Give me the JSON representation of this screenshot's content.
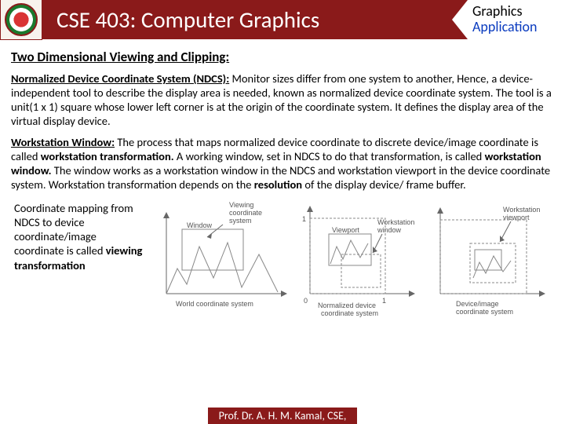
{
  "header": {
    "title": "CSE 403: Computer Graphics",
    "corner_line1": "Graphics",
    "corner_line2": "Application"
  },
  "section_title": "Two Dimensional Viewing and Clipping:",
  "p1": {
    "lead": "Normalized Device Coordinate System (NDCS):",
    "body": " Monitor sizes differ from one system to another, Hence, a device-independent tool to describe the display area is needed, known as normalized device coordinate system. The tool is a unit(1 x 1) square whose lower left corner is at the origin of the coordinate system. It defines the display area of the virtual display device."
  },
  "p2": {
    "lead": "Workstation Window:",
    "t1": " The process that maps normalized device coordinate to discrete device/image coordinate is called ",
    "b1": "workstation transformation.",
    "t2": " A working window, set in NDCS to do that transformation, is called ",
    "b2": "workstation window.",
    "t3": " The window works as a workstation window in the NDCS and workstation viewport in the device coordinate system. Workstation transformation depends on the ",
    "b3": "resolution",
    "t4": " of the display device/ frame buffer."
  },
  "caption": {
    "t1": "Coordinate mapping from NDCS to device coordinate/image coordinate is called ",
    "b1": "viewing transformation"
  },
  "diag_labels": {
    "viewing_top": "Viewing",
    "viewing_bottom": "coordinate",
    "viewing_bottom2": "system",
    "window": "Window",
    "world": "World coordinate system",
    "viewport": "Viewport",
    "one": "1",
    "zero": "0",
    "norm": "Normalized device",
    "coord_sys": "coordinate system",
    "ws_window": "Workstation",
    "ws_window2": "window",
    "ws_viewport": "Workstation",
    "ws_viewport2": "viewport",
    "dev": "Device/image",
    "dev2": "coordinate system"
  },
  "footer": "Prof. Dr. A. H. M. Kamal, CSE,"
}
